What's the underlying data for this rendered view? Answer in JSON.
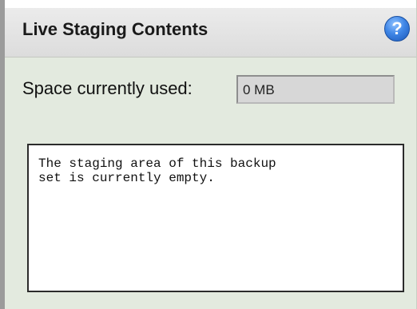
{
  "panel": {
    "title": "Live Staging Contents",
    "help_icon": "?",
    "space_label": "Space currently used:",
    "space_value": "0 MB",
    "contents_text": "The staging area of this backup\nset is currently empty."
  },
  "colors": {
    "panel_background": "#e3eadf",
    "header_background": "#dcdcdc",
    "help_icon": "#3f86e6"
  },
  "icons": {
    "help": "help-icon"
  }
}
